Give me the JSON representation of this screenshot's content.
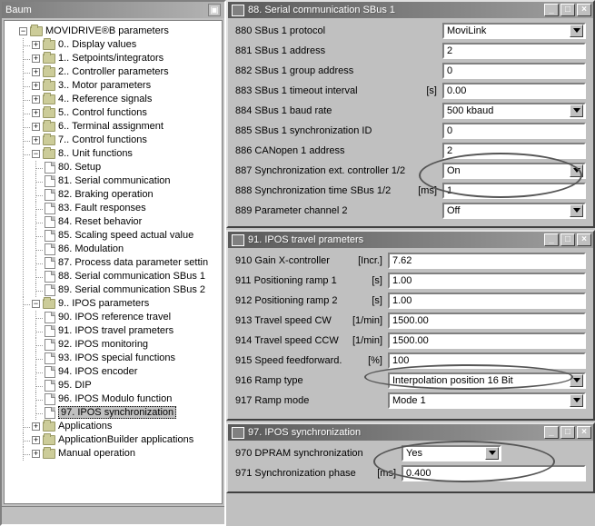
{
  "tree": {
    "title": "Baum",
    "root": "MOVIDRIVE®B parameters",
    "groups": [
      "0.. Display values",
      "1.. Setpoints/integrators",
      "2.. Controller parameters",
      "3.. Motor parameters",
      "4.. Reference signals",
      "5.. Control functions",
      "6.. Terminal assignment",
      "7.. Control functions"
    ],
    "g8": {
      "label": "8.. Unit functions",
      "items": [
        "80. Setup",
        "81. Serial communication",
        "82. Braking operation",
        "83. Fault responses",
        "84. Reset behavior",
        "85. Scaling speed actual value",
        "86. Modulation",
        "87. Process data parameter settin",
        "88. Serial communication SBus 1",
        "89. Serial communication SBus 2"
      ]
    },
    "g9": {
      "label": "9.. IPOS parameters",
      "items": [
        "90. IPOS reference travel",
        "91. IPOS travel prameters",
        "92. IPOS monitoring",
        "93. IPOS special functions",
        "94. IPOS encoder",
        "95. DIP",
        "96. IPOS Modulo function",
        "97. IPOS synchronization"
      ]
    },
    "bottom": [
      "Applications",
      "ApplicationBuilder applications",
      "Manual operation"
    ]
  },
  "win88": {
    "title": "88. Serial communication SBus 1",
    "rows": {
      "r880": {
        "label": "880 SBus 1 protocol",
        "value": "MoviLink",
        "type": "combo"
      },
      "r881": {
        "label": "881 SBus 1 address",
        "value": "2",
        "type": "field"
      },
      "r882": {
        "label": "882 SBus 1 group address",
        "value": "0",
        "type": "field"
      },
      "r883": {
        "label": "883 SBus 1 timeout interval",
        "unit": "[s]",
        "value": "0.00",
        "type": "field"
      },
      "r884": {
        "label": "884 SBus 1 baud rate",
        "value": "500 kbaud",
        "type": "combo"
      },
      "r885": {
        "label": "885 SBus 1 synchronization ID",
        "value": "0",
        "type": "field"
      },
      "r886": {
        "label": "886 CANopen 1 address",
        "value": "2",
        "type": "field"
      },
      "r887": {
        "label": "887 Synchronization ext. controller 1/2",
        "value": "On",
        "type": "combo"
      },
      "r888": {
        "label": "888 Synchronization time SBus 1/2",
        "unit": "[ms]",
        "value": "1",
        "type": "field"
      },
      "r889": {
        "label": "889 Parameter channel 2",
        "value": "Off",
        "type": "combo"
      }
    }
  },
  "win91": {
    "title": "91. IPOS travel prameters",
    "rows": {
      "r910": {
        "label": "910 Gain X-controller",
        "unit": "[Incr.]",
        "value": "7.62"
      },
      "r911": {
        "label": "911 Positioning ramp 1",
        "unit": "[s]",
        "value": "1.00"
      },
      "r912": {
        "label": "912 Positioning ramp 2",
        "unit": "[s]",
        "value": "1.00"
      },
      "r913": {
        "label": "913 Travel speed CW",
        "unit": "[1/min]",
        "value": "1500.00"
      },
      "r914": {
        "label": "914 Travel speed CCW",
        "unit": "[1/min]",
        "value": "1500.00"
      },
      "r915": {
        "label": "915 Speed feedforward.",
        "unit": "[%]",
        "value": "100"
      },
      "r916": {
        "label": "916 Ramp type",
        "value": "Interpolation position 16 Bit",
        "type": "combo"
      },
      "r917": {
        "label": "917 Ramp mode",
        "value": "Mode 1",
        "type": "combo"
      }
    }
  },
  "win97": {
    "title": "97. IPOS synchronization",
    "rows": {
      "r970": {
        "label": "970 DPRAM synchronization",
        "value": "Yes",
        "type": "combo"
      },
      "r971": {
        "label": "971 Synchronization phase",
        "unit": "[ms]",
        "value": "0.400"
      }
    }
  }
}
